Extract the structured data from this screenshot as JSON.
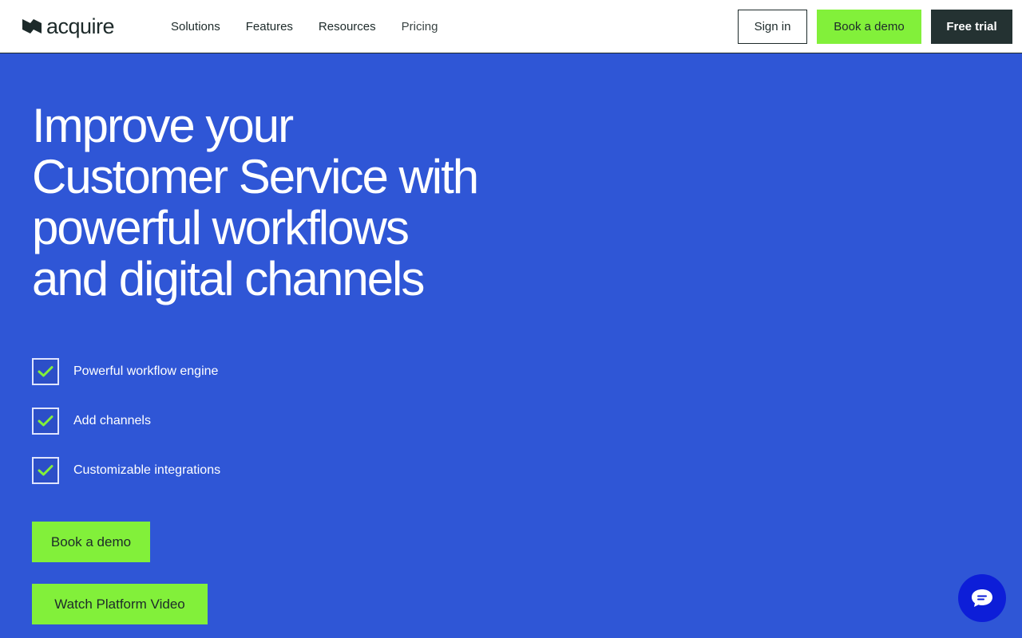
{
  "header": {
    "logo_text": "acquire",
    "nav": [
      "Solutions",
      "Features",
      "Resources",
      "Pricing"
    ],
    "sign_in": "Sign in",
    "book_demo": "Book a demo",
    "free_trial": "Free trial"
  },
  "hero": {
    "title_lines": [
      "Improve your",
      "Customer Service with",
      "powerful workflows",
      "and digital channels"
    ],
    "features": [
      "Powerful workflow engine",
      "Add channels",
      "Customizable integrations"
    ],
    "book_demo": "Book a demo",
    "watch_video": "Watch Platform Video"
  },
  "icons": {
    "logo": "acquire-logo-icon",
    "check": "check-icon",
    "chat": "chat-bubble-icon"
  },
  "colors": {
    "background": "#2f56d6",
    "accent": "#82f03a",
    "dark": "#243232",
    "chat": "#0d1ed8"
  }
}
